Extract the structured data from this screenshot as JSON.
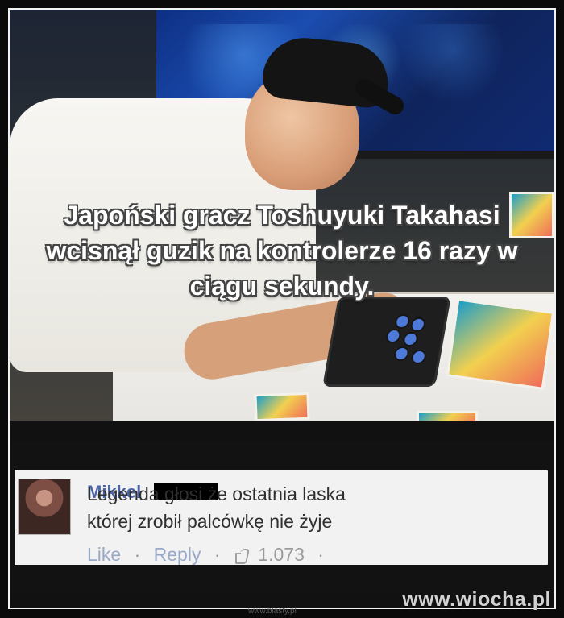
{
  "meme": {
    "caption": "Japoński gracz Toshuyuki Takahasi\nwcisnął guzik na kontrolerze 16 razy\nw ciągu sekundy.",
    "comment": {
      "author": "Mikkel",
      "text": "Legenda głosi że ostatnia laska\nktórej zrobił palcówkę nie żyje",
      "like_label": "Like",
      "reply_label": "Reply",
      "count": "1.073"
    },
    "watermark": "www.wiocha.pl",
    "small_watermark": "www.blasty.pl"
  },
  "colors": {
    "frame": "#f2f2f2",
    "background": "#0a0a0a",
    "author_link": "#4b63a5"
  },
  "icons": {
    "thumb": "thumbs-up-icon"
  }
}
